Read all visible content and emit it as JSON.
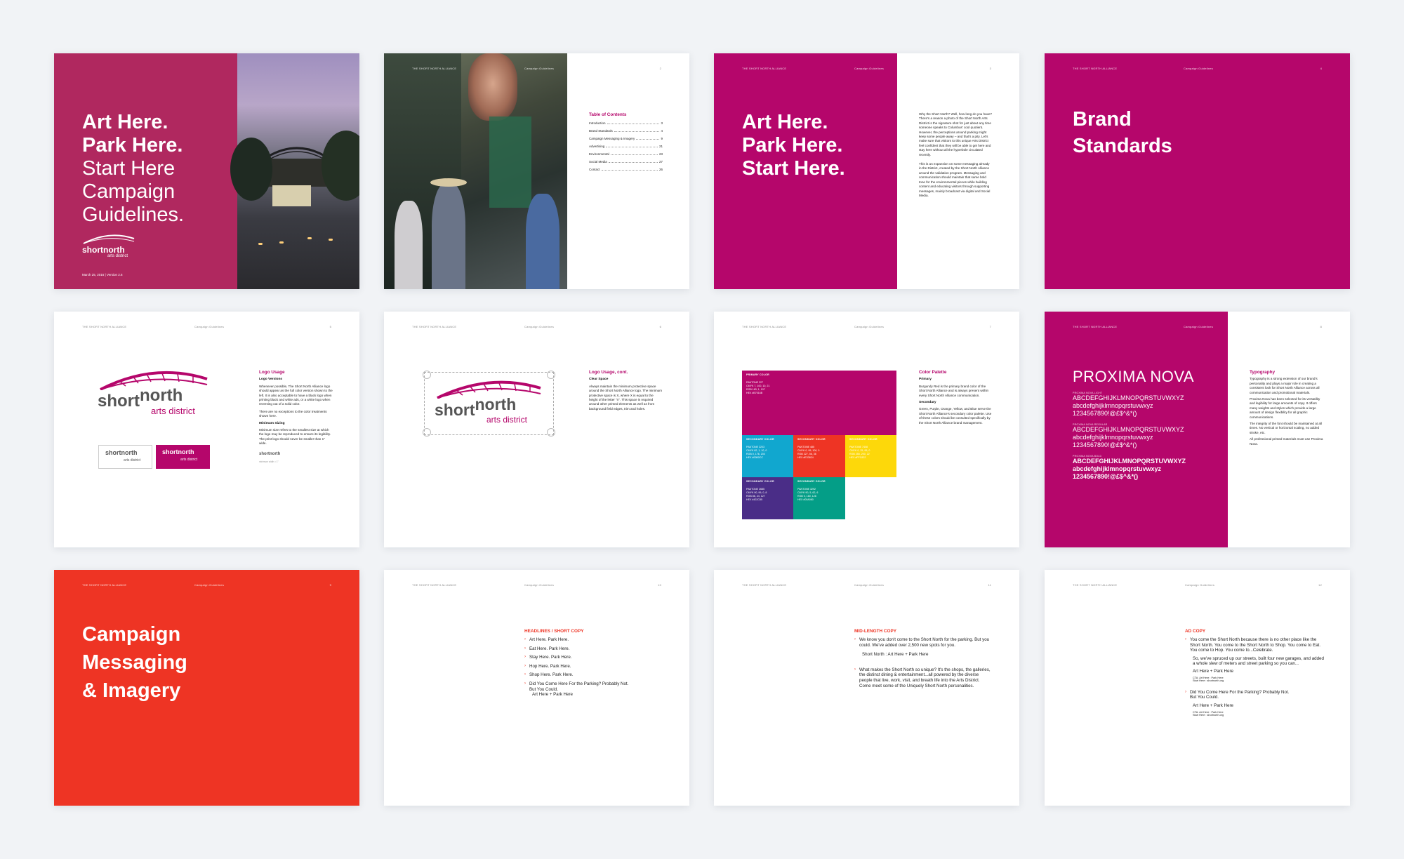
{
  "page1": {
    "title_lines": [
      "Art Here.",
      "Park Here."
    ],
    "subtitle_lines": [
      "Start Here",
      "Campaign",
      "Guidelines."
    ],
    "logo_top": "short",
    "logo_north": "north",
    "logo_bottom": "arts district",
    "date": "March 25, 2016  |  Version 2.6"
  },
  "page2": {
    "header_left": "THE SHORT NORTH ALLIANCE",
    "header_mid": "Campaign Guidelines",
    "page_no": "2",
    "toc_title": "Table of Contents",
    "toc": [
      {
        "label": "Introduction",
        "page": "3"
      },
      {
        "label": "Brand Standards",
        "page": "4"
      },
      {
        "label": "Campaign Messaging & Imagery",
        "page": "9"
      },
      {
        "label": "Advertising",
        "page": "21"
      },
      {
        "label": "Environmental",
        "page": "23"
      },
      {
        "label": "Social Media",
        "page": "27"
      },
      {
        "label": "Contact",
        "page": "26"
      }
    ]
  },
  "page3": {
    "header_left": "THE SHORT NORTH ALLIANCE",
    "header_mid": "Campaign Guidelines",
    "page_no": "3",
    "title_lines": [
      "Art Here.",
      "Park Here.",
      "Start Here."
    ],
    "para1": "Why the Short North? Well, how long do you have? There's a reason a photo of the Short North Arts District is the signature shot for just about any time someone speaks to Columbus' cool quotient. However, the perceptions around parking might keep some people away – and that's a pity. Let's make sure that visitors to this unique Arts District feel confident that they will be able to get here and stay here without all the hyperbole circulated recently.",
    "para2": "This is an expansion on some messaging already in the District, created by the Short North Alliance around the validation program. Messaging and communication should maintain that same bold tone for the environmental pieces while building content and educating visitors through supporting messages, mainly broadcast via digital and Social Media."
  },
  "page4": {
    "header_left": "THE SHORT NORTH ALLIANCE",
    "header_mid": "Campaign Guidelines",
    "page_no": "4",
    "title_lines": [
      "Brand",
      "Standards"
    ]
  },
  "page5": {
    "header_left": "THE SHORT NORTH ALLIANCE",
    "header_mid": "Campaign Guidelines",
    "page_no": "5",
    "title": "Logo Usage",
    "sub1": "Logo Versions",
    "text1": "Whenever possible, The Short North Alliance logo should appear as the full color version shown to the left. It is also acceptable to have a black logo when printing black and white ads, or a white logo when reversing out of a solid color.",
    "text2": "There are no exceptions to the color treatments shown here.",
    "sub2": "Minimum Sizing",
    "text3": "Minimum size refers to the smallest size at which the logo may be reproduced to ensure its legibility. The print logo should never be smaller than 1\" wide.",
    "min_label": "minimum width = 1\""
  },
  "page6": {
    "header_left": "THE SHORT NORTH ALLIANCE",
    "header_mid": "Campaign Guidelines",
    "page_no": "6",
    "title": "Logo Usage, cont.",
    "sub1": "Clear Space",
    "text1": "Always maintain the minimum protective space around the Short North Alliance logo. The minimum protective space is X, where X is equal to the height of the letter \"n\". This space is required around other printed elements as well as from background field edges, trim and holes."
  },
  "page7": {
    "header_left": "THE SHORT NORTH ALLIANCE",
    "header_mid": "Campaign Guidelines",
    "page_no": "7",
    "title": "Color Palette",
    "sub1": "Primary",
    "text1": "Burgundy Red is the primary brand color of the Short North Alliance and is always present within every Short North Alliance communication.",
    "sub2": "Secondary",
    "text2": "Green, Purple, Orange, Yellow, and Blue serve the Short North Alliance's secondary color palette. Use of these colors should be consulted specifically by the Short North Alliance brand management.",
    "swatches": [
      {
        "label": "PRIMARY COLOR",
        "lines": [
          "PANTONE 227",
          "CMYK  7, 100, 10, 21",
          "RGB   183, 1, 107",
          "HEX   #B7016B"
        ],
        "color": "#b5066b"
      },
      {
        "label": "SECONDARY COLOR",
        "lines": [
          "PANTONE 2203",
          "CMYK  82, 1, 10, 0",
          "RGB   0, 176, 204",
          "HEX   #00B0CC"
        ],
        "color": "#11a7cf"
      },
      {
        "label": "SECONDARY COLOR",
        "lines": [
          "PANTONE 485",
          "CMYK  0, 95, 100, 0",
          "RGB   227, 56, 36",
          "HEX   #E33824"
        ],
        "color": "#ee3424"
      },
      {
        "label": "SECONDARY COLOR",
        "lines": [
          "PANTONE 7408",
          "CMYK  0, 25, 95, 0",
          "RGB   255, 200, 22",
          "HEX   #FFC822"
        ],
        "color": "#fdd80a"
      },
      {
        "label": "SECONDARY COLOR",
        "lines": [
          "PANTONE 2685",
          "CMYK  90, 99, 0, 8",
          "RGB   86, 44, 127",
          "HEX   #422C85"
        ],
        "color": "#4a2d87"
      },
      {
        "label": "SECONDARY COLOR",
        "lines": [
          "PANTONE 3292",
          "CMYK  90, 5, 62, 6",
          "RGB   0, 160, 128",
          "HEX   #00A080"
        ],
        "color": "#049e87"
      }
    ]
  },
  "page8": {
    "header_left": "THE SHORT NORTH ALLIANCE",
    "header_mid": "Campaign Guidelines",
    "page_no": "8",
    "font_name": "PROXIMA NOVA",
    "weights": [
      {
        "label": "PROXIMA NOVA LIGHT",
        "upper": "ABCDEFGHIJKLMNOPQRSTUVWXYZ",
        "lower": "abcdefghijklmnopqrstuvwxyz",
        "nums": "1234567890!@£$^&*()"
      },
      {
        "label": "PROXIMA NOVA REGULAR",
        "upper": "ABCDEFGHIJKLMNOPQRSTUVWXYZ",
        "lower": "abcdefghijklmnopqrstuvwxyz",
        "nums": "1234567890!@£$^&*()"
      },
      {
        "label": "PROXIMA NOVA BOLD",
        "upper": "ABCDEFGHIJKLMNOPQRSTUVWXYZ",
        "lower": "abcdefghijklmnopqrstuvwxyz",
        "nums": "1234567890!@£$^&*()"
      }
    ],
    "title": "Typography",
    "text1": "Typography is a strong extension of our brand's personality and plays a major role in creating a consistent look for Short North Alliance across all communication and promotional materials.",
    "text2": "Proxima Nova has been selected for its versatility and legibility for large amounts of copy. It offers many weights and styles which provide a large amount of design flexibility for all graphic communications.",
    "text3": "The integrity of the font should be maintained at all times. No vertical or horizontal scaling, no added stroke, etc.",
    "text4": "All professional printed materials must use Proxima Nova."
  },
  "page9": {
    "header_left": "THE SHORT NORTH ALLIANCE",
    "header_mid": "Campaign Guidelines",
    "page_no": "9",
    "title_lines": [
      "Campaign",
      "Messaging",
      "& Imagery"
    ]
  },
  "page10": {
    "header_left": "THE SHORT NORTH ALLIANCE",
    "header_mid": "Campaign Guidelines",
    "page_no": "10",
    "title": "HEADLINES / SHORT COPY",
    "bullets": [
      "Art Here. Park Here.",
      "Eat Here. Park Here.",
      "Stay Here. Park Here.",
      "Hop Here. Park Here.",
      "Shop Here. Park Here.",
      "Did You Come Here For the Parking? Probably Not. But You Could."
    ],
    "tail": "Art Here + Park Here"
  },
  "page11": {
    "header_left": "THE SHORT NORTH ALLIANCE",
    "header_mid": "Campaign Guidelines",
    "page_no": "11",
    "title": "MID-LENGTH COPY",
    "bullet1": "We know you don't come to the Short North for the parking. But you could. We've added over 2,500 new spots for you.",
    "line1": "Short North : Art Here + Park Here",
    "bullet2": "What makes the Short North so unique? It's the shops, the galleries, the distinct dining & entertainment...all powered by the diverse people that live, work, visit, and breath life into the Arts District. Come meet some of the Uniquely Short North personalities."
  },
  "page12": {
    "header_left": "THE SHORT NORTH ALLIANCE",
    "header_mid": "Campaign Guidelines",
    "page_no": "12",
    "title": "AD COPY",
    "bullet1": "You come the Short North because there is no other place like the Short North. You come to the Short North to Shop. You come to Eat. You come to Hop. You come to...Celebrate.",
    "line1": "So, we've spruced up our streets, built four new garages, and added a whole slew of meters and street parking so you can...",
    "line2": "Art Here + Park Here",
    "cta1": "CTA: Art Here : Park Here",
    "cta1b": "Start Here : shortnorth.org",
    "bullet2": "Did You Come Here For the Parking? Probably Not. But You Could.",
    "line3": "Art Here + Park Here",
    "cta2": "CTA: Art Here : Park Here",
    "cta2b": "Start Here : shortnorth.org"
  }
}
